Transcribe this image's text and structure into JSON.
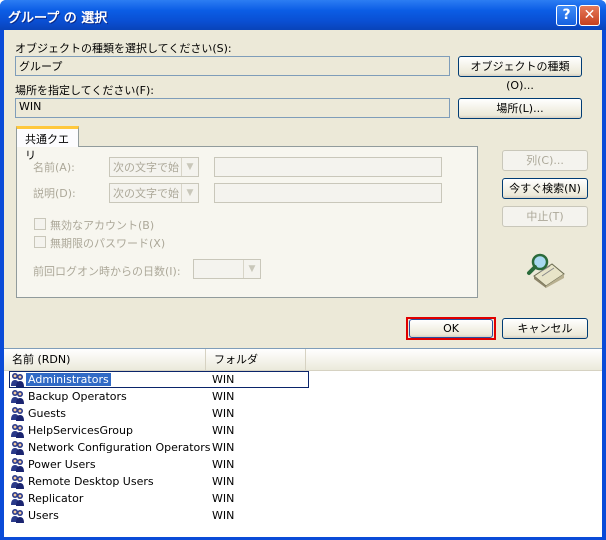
{
  "window": {
    "title": "グループ の 選択",
    "help_glyph": "?",
    "close_glyph": "✕"
  },
  "object_type": {
    "label": "オブジェクトの種類を選択してください(S):",
    "value": "グループ",
    "button": "オブジェクトの種類(O)..."
  },
  "location": {
    "label": "場所を指定してください(F):",
    "value": "WIN",
    "button": "場所(L)..."
  },
  "query": {
    "tab": "共通クエリ",
    "name_label": "名前(A):",
    "name_mode": "次の文字で始",
    "desc_label": "説明(D):",
    "desc_mode": "次の文字で始",
    "disabled_accounts": "無効なアカウント(B)",
    "no_expire_password": "無期限のパスワード(X)",
    "days_since_logon": "前回ログオン時からの日数(I):"
  },
  "side_buttons": {
    "columns": "列(C)...",
    "find_now": "今すぐ検索(N)",
    "stop": "中止(T)"
  },
  "dialog_buttons": {
    "ok": "OK",
    "cancel": "キャンセル"
  },
  "results": {
    "columns": [
      "名前 (RDN)",
      "フォルダ"
    ],
    "rows": [
      {
        "name": "Administrators",
        "folder": "WIN"
      },
      {
        "name": "Backup Operators",
        "folder": "WIN"
      },
      {
        "name": "Guests",
        "folder": "WIN"
      },
      {
        "name": "HelpServicesGroup",
        "folder": "WIN"
      },
      {
        "name": "Network Configuration Operators",
        "folder": "WIN"
      },
      {
        "name": "Power Users",
        "folder": "WIN"
      },
      {
        "name": "Remote Desktop Users",
        "folder": "WIN"
      },
      {
        "name": "Replicator",
        "folder": "WIN"
      },
      {
        "name": "Users",
        "folder": "WIN"
      }
    ],
    "selected_index": 0
  },
  "colors": {
    "title_bar": "#0a4fd3",
    "dialog_bg": "#ece9d8",
    "ok_highlight": "#e00000",
    "selection": "#316ac5"
  },
  "icons": [
    "help-icon",
    "close-icon",
    "search-magnifier-icon",
    "group-icon"
  ]
}
